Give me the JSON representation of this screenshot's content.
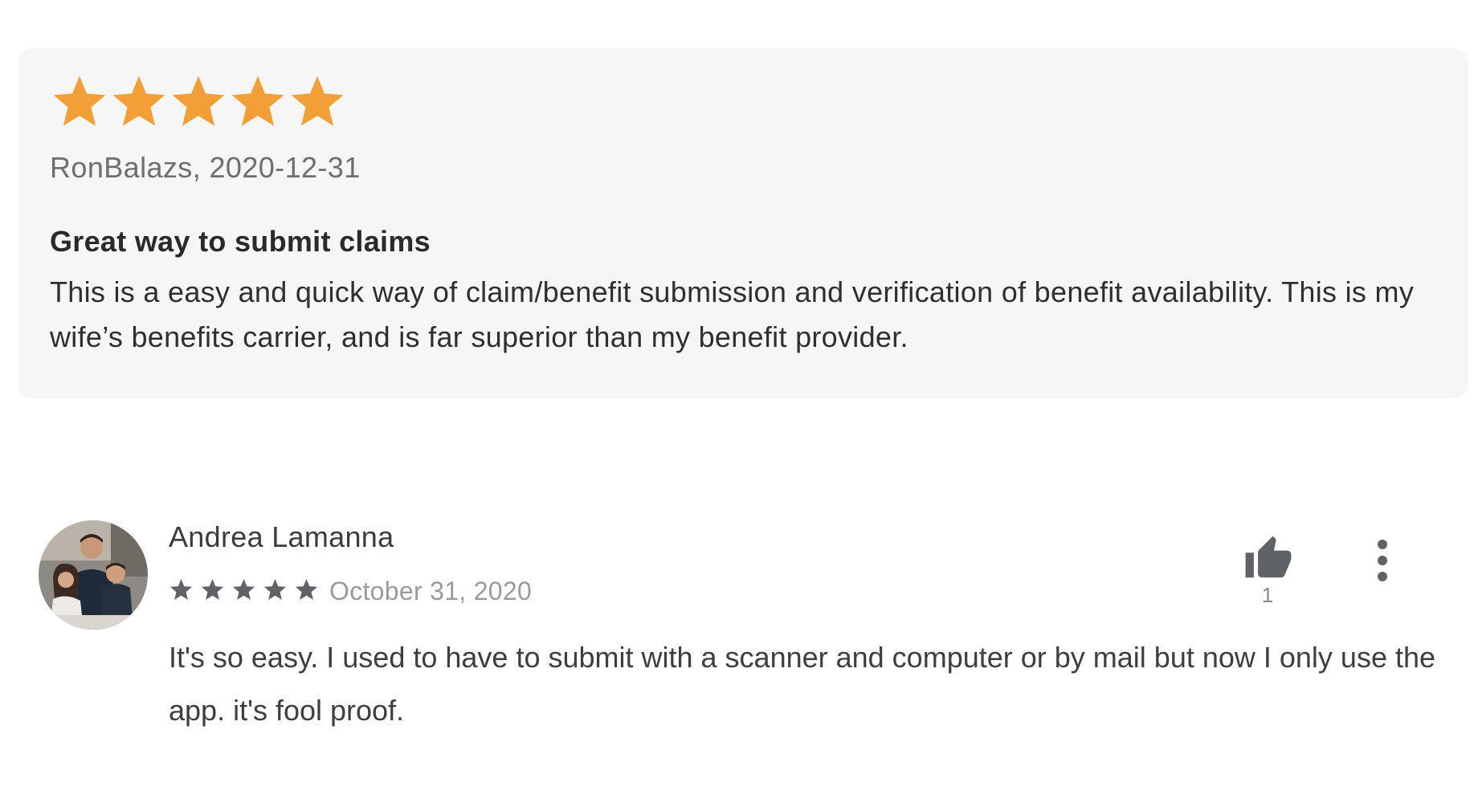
{
  "colors": {
    "card_background": "#f6f6f6",
    "appstore_star": "#f29f38",
    "playstore_star": "#5f6368",
    "meta_text": "#6e6e6e",
    "date_text": "#9a9a9a"
  },
  "appstore_review": {
    "rating": 5,
    "rating_max": 5,
    "star_icon": "star-filled-icon",
    "author": "RonBalazs",
    "date": "2020-12-31",
    "meta": "RonBalazs, 2020-12-31",
    "title": "Great way to submit claims",
    "body": "This is a easy and quick way of claim/benefit submission and verification of benefit availability. This is my wife’s benefits carrier, and is far superior than my benefit provider."
  },
  "playstore_review": {
    "author": "Andrea Lamanna",
    "avatar_icon": "profile-photo",
    "rating": 5,
    "rating_max": 5,
    "star_icon": "star-filled-icon",
    "date": "October 31, 2020",
    "body": "It's so easy. I used to have to submit with a scanner and computer or by mail but now I only use the app. it's fool proof.",
    "helpful_icon": "thumbs-up-icon",
    "helpful_count": "1",
    "menu_icon": "more-vert-icon"
  }
}
